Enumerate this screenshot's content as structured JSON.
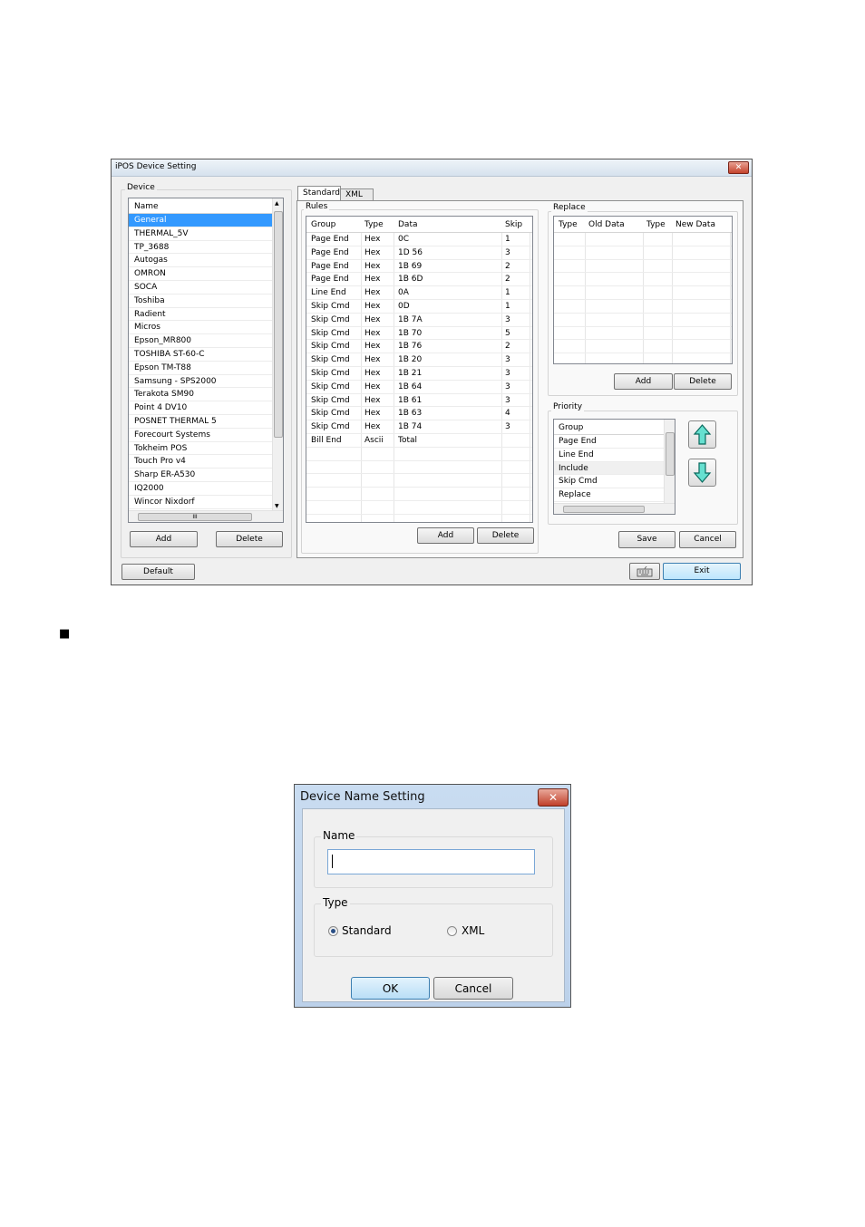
{
  "main_window": {
    "title": "iPOS Device Setting",
    "close_glyph": "✕",
    "device_group_label": "Device",
    "device_list_header": "Name",
    "devices": [
      "General",
      "THERMAL_5V",
      "TP_3688",
      "Autogas",
      "OMRON",
      "SOCA",
      "Toshiba",
      "Radient",
      "Micros",
      "Epson_MR800",
      "TOSHIBA ST-60-C",
      "Epson TM-T88",
      "Samsung - SPS2000",
      "Terakota SM90",
      "Point 4 DV10",
      "POSNET THERMAL 5",
      "Forecourt Systems",
      "Tokheim POS",
      "Touch Pro v4",
      "Sharp ER-A530",
      "IQ2000",
      "Wincor Nixdorf"
    ],
    "selected_device": "General",
    "device_add_label": "Add",
    "device_delete_label": "Delete",
    "default_label": "Default",
    "exit_label": "Exit",
    "tabs": [
      "Standard",
      "XML"
    ],
    "active_tab": "Standard",
    "rules": {
      "label": "Rules",
      "columns": [
        "Group",
        "Type",
        "Data",
        "Skip"
      ],
      "rows": [
        [
          "Page End",
          "Hex",
          "0C",
          "1"
        ],
        [
          "Page End",
          "Hex",
          "1D 56",
          "3"
        ],
        [
          "Page End",
          "Hex",
          "1B 69",
          "2"
        ],
        [
          "Page End",
          "Hex",
          "1B 6D",
          "2"
        ],
        [
          "Line End",
          "Hex",
          "0A",
          "1"
        ],
        [
          "Skip Cmd",
          "Hex",
          "0D",
          "1"
        ],
        [
          "Skip Cmd",
          "Hex",
          "1B 7A",
          "3"
        ],
        [
          "Skip Cmd",
          "Hex",
          "1B 70",
          "5"
        ],
        [
          "Skip Cmd",
          "Hex",
          "1B 76",
          "2"
        ],
        [
          "Skip Cmd",
          "Hex",
          "1B 20",
          "3"
        ],
        [
          "Skip Cmd",
          "Hex",
          "1B 21",
          "3"
        ],
        [
          "Skip Cmd",
          "Hex",
          "1B 64",
          "3"
        ],
        [
          "Skip Cmd",
          "Hex",
          "1B 61",
          "3"
        ],
        [
          "Skip Cmd",
          "Hex",
          "1B 63",
          "4"
        ],
        [
          "Skip Cmd",
          "Hex",
          "1B 74",
          "3"
        ],
        [
          "Bill End",
          "Ascii",
          "Total",
          ""
        ]
      ],
      "add_label": "Add",
      "delete_label": "Delete"
    },
    "replace": {
      "label": "Replace",
      "columns": [
        "Type",
        "Old Data",
        "Type",
        "New Data"
      ],
      "add_label": "Add",
      "delete_label": "Delete"
    },
    "priority": {
      "label": "Priority",
      "header": "Group",
      "items": [
        "Page End",
        "Line End",
        "Include",
        "Skip Cmd",
        "Replace"
      ],
      "selected": "Include",
      "up_icon": "up-arrow-icon",
      "down_icon": "down-arrow-icon"
    },
    "save_label": "Save",
    "cancel_label": "Cancel",
    "keyboard_icon": "keyboard-icon",
    "scroll_glyph": "III"
  },
  "bullet_marker": "■",
  "dialog": {
    "title": "Device Name Setting",
    "close_glyph": "✕",
    "name_label": "Name",
    "name_value": "",
    "type_label": "Type",
    "type_options": [
      "Standard",
      "XML"
    ],
    "type_selected": "Standard",
    "ok_label": "OK",
    "cancel_label": "Cancel"
  },
  "colors": {
    "selection": "#3399ff",
    "arrow_fill": "#66e0d0",
    "title_close": "#c4432d"
  }
}
